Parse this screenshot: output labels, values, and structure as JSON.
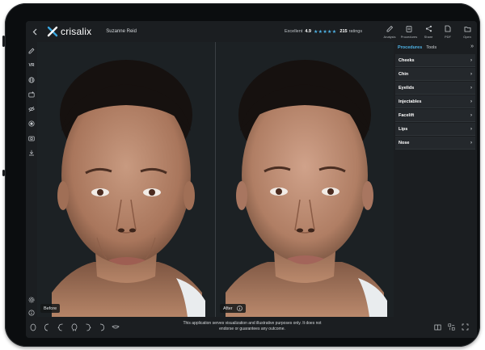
{
  "app": {
    "brand": "crisalix",
    "patient_name": "Suzanne Reid"
  },
  "rating": {
    "label": "Excellent",
    "score": "4.9",
    "stars": 4.9,
    "count": "215",
    "unit": "ratings"
  },
  "top_tools": [
    {
      "label": "Analysis",
      "icon": "pencil-ruler-icon"
    },
    {
      "label": "Procedures",
      "icon": "clipboard-icon"
    },
    {
      "label": "Share",
      "icon": "share-icon"
    },
    {
      "label": "PDF",
      "icon": "pdf-icon"
    },
    {
      "label": "Open",
      "icon": "folder-icon"
    }
  ],
  "left_tools": [
    "pencil-icon",
    "vr-icon",
    "globe-icon",
    "camera-add-icon",
    "eye-off-icon",
    "record-icon",
    "camera-icon",
    "download-icon",
    "settings-icon",
    "info-icon"
  ],
  "left_tools_vr_label": "VR",
  "viewer": {
    "before_label": "Before",
    "after_label": "After"
  },
  "panel": {
    "tabs": [
      "Procedures",
      "Tools"
    ],
    "active_tab": "Procedures",
    "items": [
      "Cheeks",
      "Chin",
      "Eyelids",
      "Injectables",
      "Facelift",
      "Lips",
      "Nose"
    ]
  },
  "footer": {
    "disclaimer": "This application serves visualization and illustrative purposes only. It does not endorse or guarantees any outcome."
  },
  "colors": {
    "accent": "#4fb3e6",
    "background": "#181b1e",
    "panel": "#1b1e21"
  }
}
